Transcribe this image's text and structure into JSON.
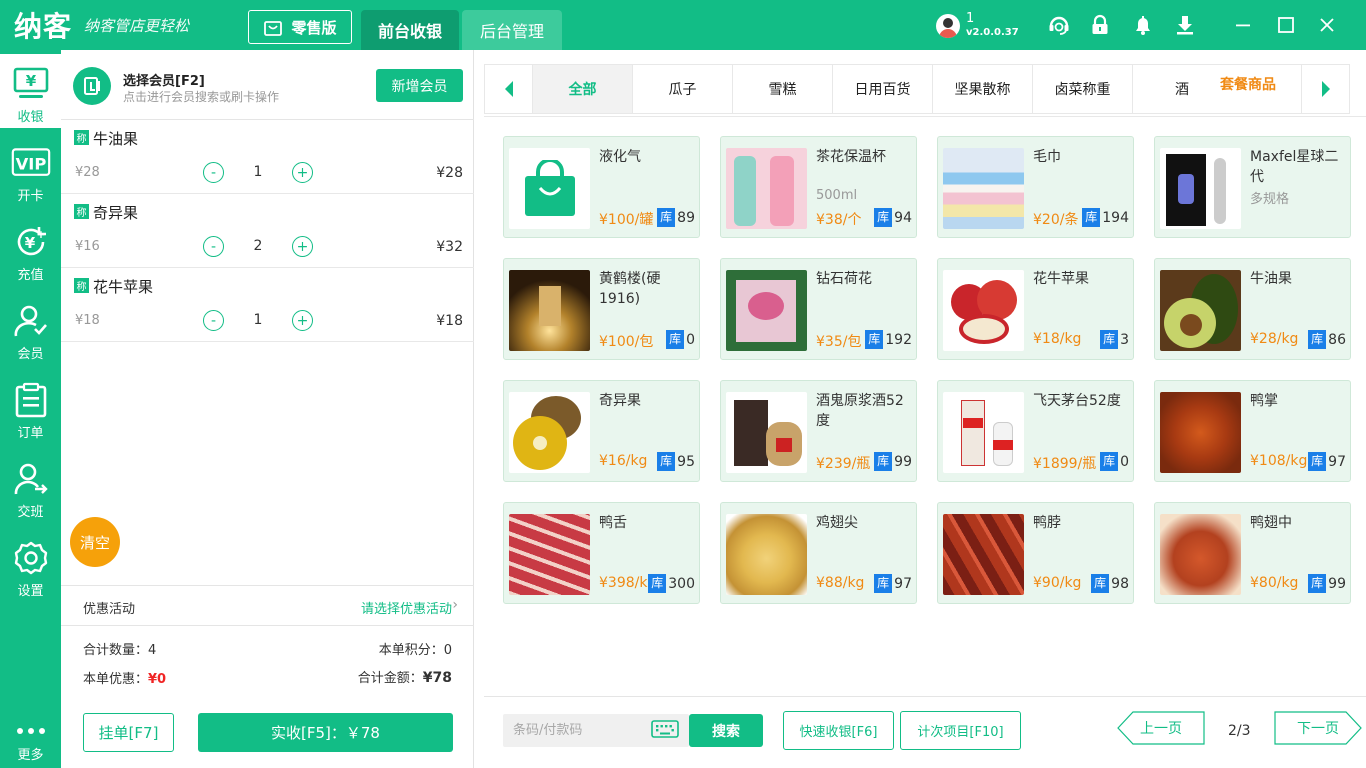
{
  "app": {
    "brand": "纳客",
    "slogan": "纳客管店更轻松",
    "edition": "零售版"
  },
  "tabs": [
    {
      "label": "前台收银",
      "active": true
    },
    {
      "label": "后台管理",
      "active": false
    }
  ],
  "user": {
    "name": "1",
    "version": "v2.0.0.37"
  },
  "nav": [
    {
      "label": "收银",
      "icon": "cashier-icon",
      "active": true
    },
    {
      "label": "开卡",
      "icon": "vip-card-icon"
    },
    {
      "label": "充值",
      "icon": "recharge-icon"
    },
    {
      "label": "会员",
      "icon": "member-icon"
    },
    {
      "label": "订单",
      "icon": "order-icon"
    },
    {
      "label": "交班",
      "icon": "shift-icon"
    },
    {
      "label": "设置",
      "icon": "settings-icon"
    },
    {
      "label": "更多",
      "icon": "more-icon"
    }
  ],
  "member": {
    "title": "选择会员[F2]",
    "subtitle": "点击进行会员搜索或刷卡操作",
    "add_label": "新增会员"
  },
  "cart": {
    "weigh_tag": "称",
    "items": [
      {
        "name": "牛油果",
        "price": "¥28",
        "qty": "1",
        "subtotal": "¥28"
      },
      {
        "name": "奇异果",
        "price": "¥16",
        "qty": "2",
        "subtotal": "¥32"
      },
      {
        "name": "花牛苹果",
        "price": "¥18",
        "qty": "1",
        "subtotal": "¥18"
      }
    ],
    "minus": "-",
    "plus": "+",
    "clear_label": "清空"
  },
  "promo": {
    "label": "优惠活动",
    "action": "请选择优惠活动"
  },
  "summary": {
    "count_label": "合计数量：",
    "count": "4",
    "points_label": "本单积分：",
    "points": "0",
    "discount_label": "本单优惠：",
    "discount": "¥0",
    "total_label": "合计金额：",
    "total": "¥78"
  },
  "actions": {
    "hang": "挂单[F7]",
    "pay": "实收[F5]：￥78"
  },
  "categories": [
    "全部",
    "瓜子",
    "雪糕",
    "日用百货",
    "坚果散称",
    "卤菜称重",
    "酒"
  ],
  "package_label": "套餐商品",
  "stock_tag": "库",
  "products": [
    {
      "name": "液化气",
      "spec": "",
      "price": "¥100/罐",
      "stock": "89"
    },
    {
      "name": "茶花保温杯",
      "spec": "500ml",
      "price": "¥38/个",
      "stock": "94"
    },
    {
      "name": "毛巾",
      "spec": "",
      "price": "¥20/条",
      "stock": "194"
    },
    {
      "name": "Maxfel星球二代",
      "spec": "多规格",
      "price": "",
      "stock": ""
    },
    {
      "name": "黄鹤楼(硬1916)",
      "spec": "",
      "price": "¥100/包",
      "stock": "0"
    },
    {
      "name": "钻石荷花",
      "spec": "",
      "price": "¥35/包",
      "stock": "192"
    },
    {
      "name": "花牛苹果",
      "spec": "",
      "price": "¥18/kg",
      "stock": "3"
    },
    {
      "name": "牛油果",
      "spec": "",
      "price": "¥28/kg",
      "stock": "86"
    },
    {
      "name": "奇异果",
      "spec": "",
      "price": "¥16/kg",
      "stock": "95"
    },
    {
      "name": "酒鬼原浆酒52度",
      "spec": "",
      "price": "¥239/瓶",
      "stock": "99"
    },
    {
      "name": "飞天茅台52度",
      "spec": "",
      "price": "¥1899/瓶",
      "stock": "0"
    },
    {
      "name": "鸭掌",
      "spec": "",
      "price": "¥108/kg",
      "stock": "97"
    },
    {
      "name": "鸭舌",
      "spec": "",
      "price": "¥398/kg",
      "stock": "300"
    },
    {
      "name": "鸡翅尖",
      "spec": "",
      "price": "¥88/kg",
      "stock": "97"
    },
    {
      "name": "鸭脖",
      "spec": "",
      "price": "¥90/kg",
      "stock": "98"
    },
    {
      "name": "鸭翅中",
      "spec": "",
      "price": "¥80/kg",
      "stock": "99"
    }
  ],
  "bottom": {
    "barcode_placeholder": "条码/付款码",
    "search": "搜索",
    "quick": "快速收银[F6]",
    "count_items": "计次项目[F10]",
    "prev": "上一页",
    "page": "2/3",
    "next": "下一页"
  },
  "colors": {
    "accent": "#12bd86",
    "price": "#f08a14",
    "stock_badge": "#1a7fe8",
    "clear": "#f6a10a",
    "discount": "#f02525"
  }
}
